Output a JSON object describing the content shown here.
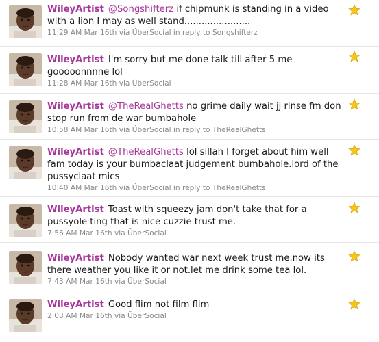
{
  "colors": {
    "author": "#a5379a",
    "mention": "#a5379a",
    "text": "#1a1a1a",
    "meta": "#8a8a8a",
    "star": "#f5c71a",
    "divider": "#e6e6e6"
  },
  "tweets": [
    {
      "author": "WileyArtist",
      "mention": "@Songshifterz",
      "text": "if chipmunk is standing in a video with a lion I may as well stand.......................",
      "meta": "11:29 AM Mar 16th via ÜberSocial in reply to Songshifterz",
      "favorite_icon": "star-icon",
      "avatar_icon": "profile-photo"
    },
    {
      "author": "WileyArtist",
      "mention": "",
      "text": "I'm sorry but me done talk till after 5 me gooooonnnne lol",
      "meta": "11:28 AM Mar 16th via ÜberSocial",
      "favorite_icon": "star-icon",
      "avatar_icon": "profile-photo"
    },
    {
      "author": "WileyArtist",
      "mention": "@TheRealGhetts",
      "text": "no grime daily wait jj rinse fm don stop run from de war bumbahole",
      "meta": "10:58 AM Mar 16th via ÜberSocial in reply to TheRealGhetts",
      "favorite_icon": "star-icon",
      "avatar_icon": "profile-photo"
    },
    {
      "author": "WileyArtist",
      "mention": "@TheRealGhetts",
      "text": "lol sillah I forget about him well fam today is your bumbaclaat judgement bumbahole.lord of the pussyclaat mics",
      "meta": "10:40 AM Mar 16th via ÜberSocial in reply to TheRealGhetts",
      "favorite_icon": "star-icon",
      "avatar_icon": "profile-photo"
    },
    {
      "author": "WileyArtist",
      "mention": "",
      "text": "Toast with squeezy jam don't take that for a pussyole ting that is nice cuzzie trust me.",
      "meta": "7:56 AM Mar 16th via ÜberSocial",
      "favorite_icon": "star-icon",
      "avatar_icon": "profile-photo"
    },
    {
      "author": "WileyArtist",
      "mention": "",
      "text": "Nobody wanted war next week trust me.now its there weather you like it or not.let me drink some tea lol.",
      "meta": "7:43 AM Mar 16th via ÜberSocial",
      "favorite_icon": "star-icon",
      "avatar_icon": "profile-photo"
    },
    {
      "author": "WileyArtist",
      "mention": "",
      "text": "Good flim not film flim",
      "meta": "2:03 AM Mar 16th via ÜberSocial",
      "favorite_icon": "star-icon",
      "avatar_icon": "profile-photo"
    }
  ]
}
